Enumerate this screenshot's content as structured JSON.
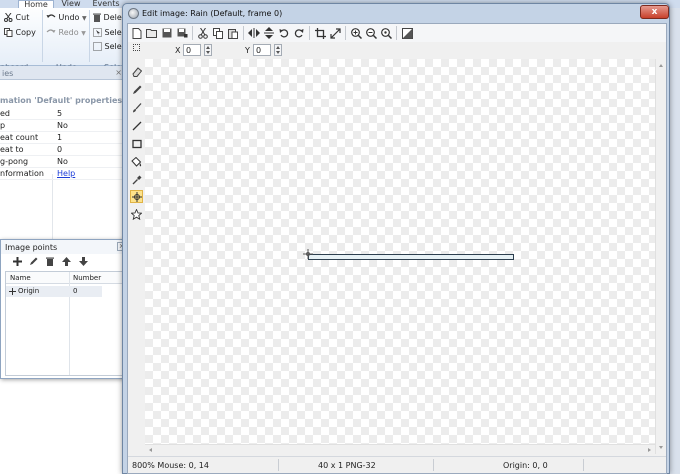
{
  "ribbon": {
    "tabs": [
      "Home",
      "View",
      "Events"
    ],
    "active_tab": "Home",
    "cut": "Cut",
    "copy": "Copy",
    "undo": "Undo",
    "redo": "Redo",
    "delete": "Dele",
    "select1": "Selec",
    "select2": "Selec",
    "group_clipboard": "pboard",
    "group_undo": "Undo",
    "group_select": "Selec"
  },
  "properties": {
    "title": "ies",
    "section": "mation 'Default' properties",
    "rows": [
      {
        "key": "ed",
        "value": "5"
      },
      {
        "key": "p",
        "value": "No"
      },
      {
        "key": "eat count",
        "value": "1"
      },
      {
        "key": "eat to",
        "value": "0"
      },
      {
        "key": "g-pong",
        "value": "No"
      },
      {
        "key": "nformation",
        "value": "Help"
      }
    ]
  },
  "image_points": {
    "title": "Image points",
    "columns": [
      "Name",
      "Number"
    ],
    "rows": [
      {
        "name": "Origin",
        "number": "0"
      }
    ],
    "close": "x"
  },
  "editor": {
    "title": "Edit image: Rain (Default, frame 0)",
    "close": "x",
    "x_label": "X",
    "x_value": "0",
    "y_label": "Y",
    "y_value": "0",
    "status": {
      "zoom_mouse": "800%  Mouse: 0, 14",
      "size_format": "40 x 1  PNG-32",
      "origin": "Origin: 0, 0"
    }
  }
}
